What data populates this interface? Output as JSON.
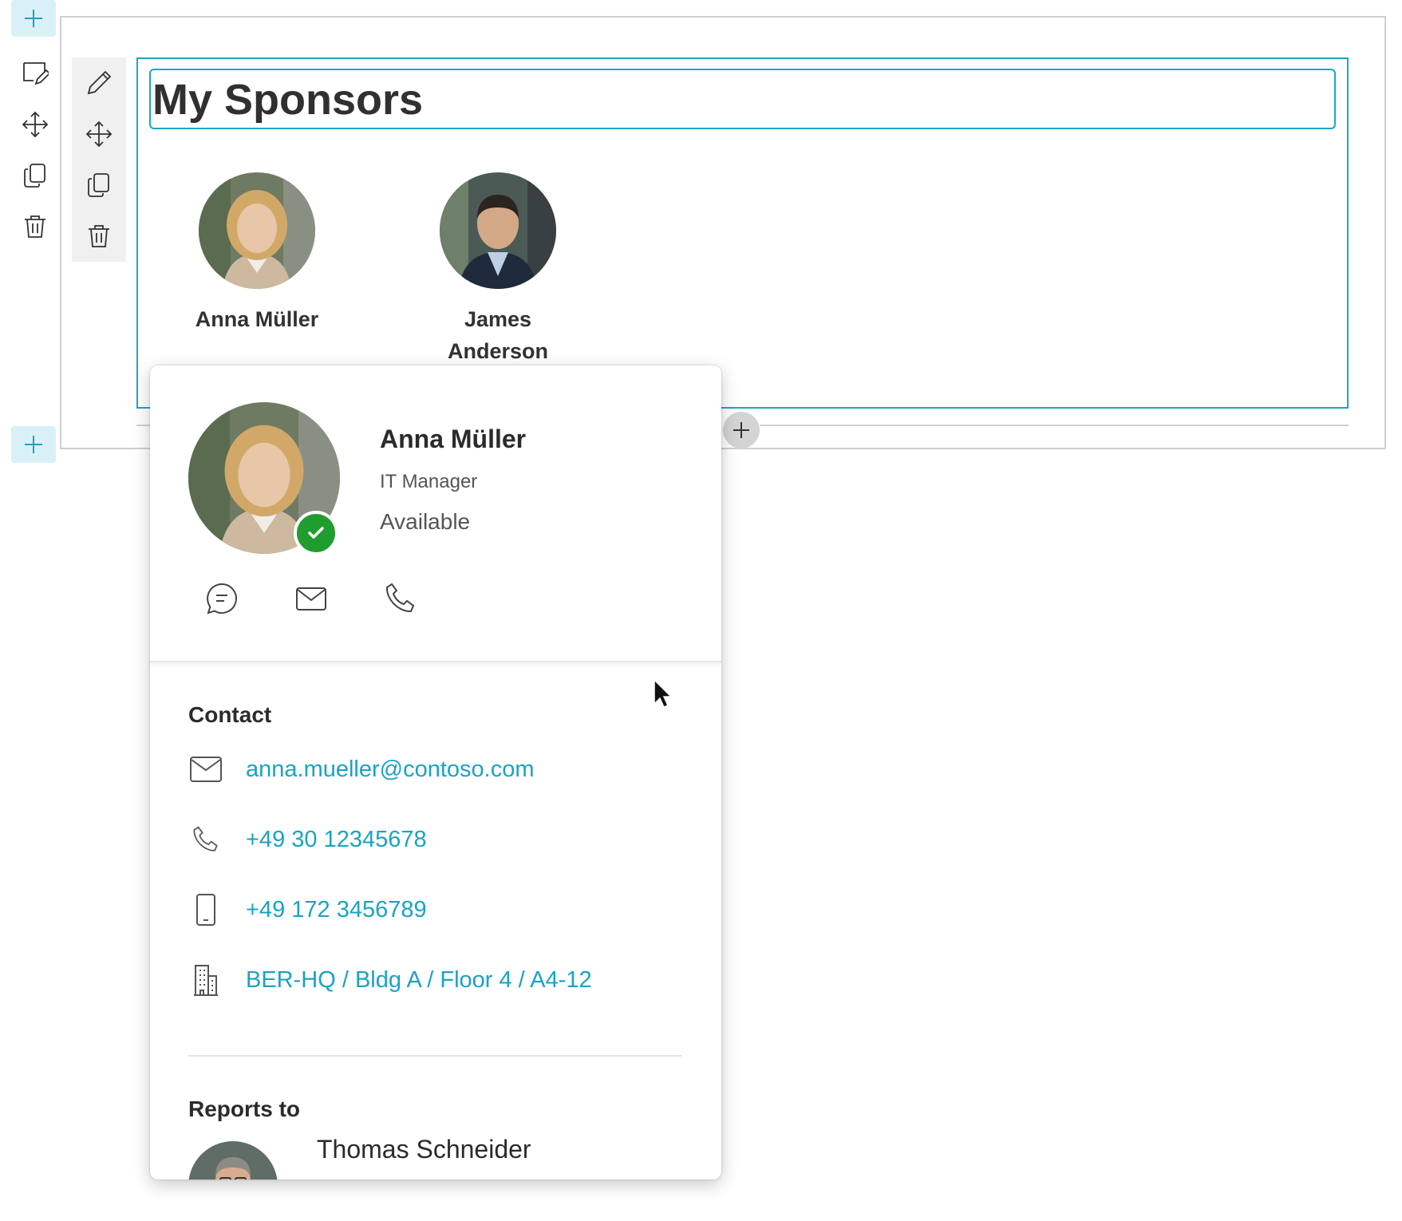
{
  "section": {
    "toolbar": [
      {
        "name": "edit-section",
        "icon": "edit-section-icon"
      },
      {
        "name": "move-section",
        "icon": "move-icon"
      },
      {
        "name": "duplicate-section",
        "icon": "duplicate-icon"
      },
      {
        "name": "delete-section",
        "icon": "delete-icon"
      }
    ]
  },
  "webpart": {
    "toolbar": [
      {
        "name": "edit-webpart",
        "icon": "pencil-icon"
      },
      {
        "name": "move-webpart",
        "icon": "move-icon"
      },
      {
        "name": "duplicate-webpart",
        "icon": "duplicate-icon"
      },
      {
        "name": "delete-webpart",
        "icon": "delete-icon"
      }
    ],
    "title": "My Sponsors",
    "people": [
      {
        "name": "Anna Müller"
      },
      {
        "name": "James Anderson"
      }
    ]
  },
  "card": {
    "name": "Anna Müller",
    "job_title": "IT Manager",
    "status": "Available",
    "status_color": "#1f9e2f",
    "actions": [
      "chat-icon",
      "mail-icon",
      "phone-icon"
    ],
    "contact_heading": "Contact",
    "email": "anna.mueller@contoso.com",
    "phone": "+49 30 12345678",
    "mobile": "+49 172 3456789",
    "office": "BER-HQ / Bldg A / Floor 4 / A4-12",
    "reports_to_heading": "Reports to",
    "manager_name": "Thomas Schneider"
  },
  "colors": {
    "accent": "#1aa7c6",
    "link": "#1aa3c4",
    "add_button_bg": "#d9f1f6"
  }
}
